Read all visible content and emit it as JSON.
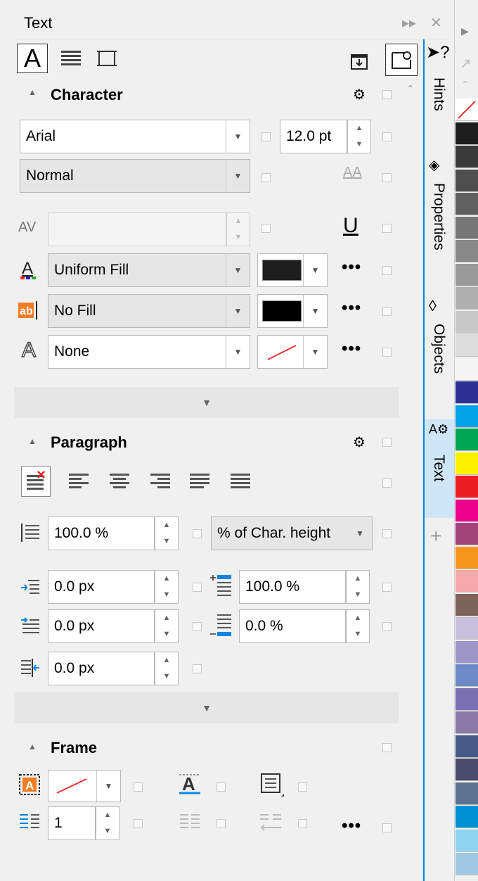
{
  "window": {
    "title": "Text"
  },
  "character": {
    "heading": "Character",
    "font_name": "Arial",
    "font_size": "12.0 pt",
    "font_style": "Normal",
    "text_fill_type": "Uniform Fill",
    "background_fill_type": "No Fill",
    "outline_type": "None"
  },
  "paragraph": {
    "heading": "Paragraph",
    "line_spacing": "100.0 %",
    "line_spacing_units": "% of Char. height",
    "left_indent": "0.0 px",
    "space_before": "100.0 %",
    "first_line_indent": "0.0 px",
    "space_after": "0.0 %",
    "right_indent": "0.0 px"
  },
  "frame": {
    "heading": "Frame",
    "columns": "1"
  },
  "docker_tabs": [
    "Hints",
    "Properties",
    "Objects",
    "Text"
  ],
  "palette_colors": [
    "#ffffff",
    "#1e1e1e",
    "#3a3a3a",
    "#4e4e4e",
    "#606060",
    "#767676",
    "#888888",
    "#9a9a9a",
    "#b0b0b0",
    "#c8c8c8",
    "#dcdcdc",
    "#f4f4f4",
    "#2b3191",
    "#00a3e8",
    "#00a651",
    "#fff200",
    "#ed1c24",
    "#ec008c",
    "#a3427b",
    "#f7941d",
    "#f6a8ab",
    "#7d6358",
    "#c8c0df",
    "#9d94c8",
    "#6d89c6",
    "#7a6fb0",
    "#8a7aa6",
    "#465a8a",
    "#4a4a6a",
    "#5d7490",
    "#0091d5",
    "#8fd3f2",
    "#a0c8e0"
  ]
}
